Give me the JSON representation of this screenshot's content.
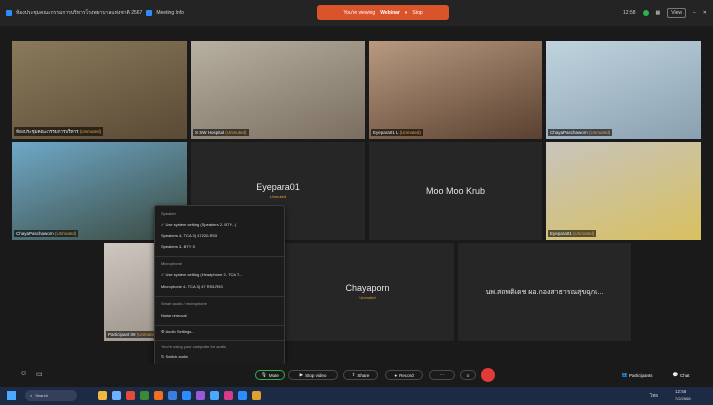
{
  "titlebar": {
    "meeting_info": "ห้องประชุมคณะกรรมการบริหารโรงพยาบาลแห่งชาติ 2567",
    "view_label": "Meeting Info",
    "recording_text": "You're viewing",
    "recording_name": "Webinar",
    "stop_label": "Stop",
    "time": "12:58",
    "view_button": "View",
    "user_label": "Zoom"
  },
  "tiles": [
    {
      "name": "ห้องประชุมคณะกรรมการบริหาร",
      "muted": "(Unmuted)",
      "type": "photo",
      "tint": [
        "#8a7a5a",
        "#5a4a36"
      ]
    },
    {
      "name": "S SW Hospital",
      "muted": "(Unmuted)",
      "type": "photo",
      "tint": [
        "#b8b0a2",
        "#7a6e60"
      ]
    },
    {
      "name": "Eyepara01 L",
      "muted": "(Unmuted)",
      "type": "photo",
      "tint": [
        "#b89a80",
        "#5a4030"
      ]
    },
    {
      "name": "ChayaPaschaworn",
      "muted": "(Unmuted)",
      "type": "photo",
      "tint": [
        "#c0d4df",
        "#8aa0b0"
      ]
    },
    {
      "name": "ChayaPaschaworn",
      "muted": "(Unmuted)",
      "type": "photo",
      "tint": [
        "#6fa8c8",
        "#3a4a40"
      ]
    },
    {
      "name": "Eyepara01",
      "sub": "Unmuted",
      "type": "dark"
    },
    {
      "name": "Moo Moo Krub",
      "sub": "",
      "type": "dark"
    },
    {
      "name": "Eyepara01",
      "muted": "(Unmuted)",
      "type": "photo",
      "tint": [
        "#c8c4bc",
        "#d8c060"
      ]
    },
    {
      "name": "Participant 09",
      "muted": "(Unmuted)",
      "type": "photo",
      "tint": [
        "#cfc8c0",
        "#8a8078"
      ]
    },
    {
      "name": "Chayaporn",
      "sub": "Unmuted",
      "type": "dark"
    },
    {
      "name": "นพ.สถพติเดช ผอ.กองสาธารณสุขฉุกเ...",
      "sub": "",
      "type": "dark"
    }
  ],
  "mic_menu": {
    "speaker_header": "Speaker",
    "speaker_opt1": "Use system setting (Speakers 2- BTY...)",
    "speaker_opt2": "Speakers 4- TCA 3) 47220-R53",
    "speaker_opt3": "Speakers 3- BTY S",
    "mic_header": "Microphone",
    "mic_opt1": "Use system setting (Headphone 2- TCA T...",
    "mic_opt2": "Microphone 4- TCA 3) 47 R53-R53",
    "audio_header": "Smart audio / microphone",
    "audio_opt1": "Noise removal",
    "audio_settings": "Audio Settings...",
    "note": "You're using your computer for audio",
    "switch": "Switch audio"
  },
  "toolbar": {
    "mute": "Mute",
    "stop_video": "Stop video",
    "share": "Share",
    "record": "Record",
    "participants": "Participants",
    "chat": "Chat"
  },
  "taskbar": {
    "search": "Search",
    "time": "12:58",
    "date": "7/2/2568",
    "lang": "ไทย"
  },
  "colors": {
    "recording_pill": "#d9542b",
    "record_dot": "#e23a3a",
    "muted_label": "#e0a030",
    "taskbar": "#1d2a44"
  }
}
